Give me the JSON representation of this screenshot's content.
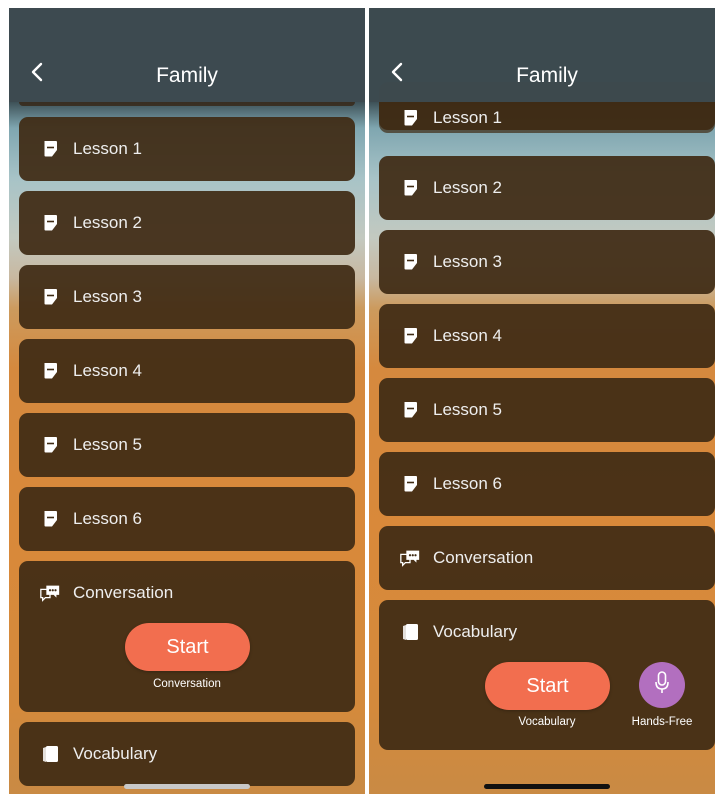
{
  "left": {
    "title": "Family",
    "lessons": [
      "Lesson 1",
      "Lesson 2",
      "Lesson 3",
      "Lesson 4",
      "Lesson 5",
      "Lesson 6"
    ],
    "conversation": {
      "label": "Conversation",
      "start_label": "Start",
      "caption": "Conversation"
    },
    "vocabulary_label": "Vocabulary"
  },
  "right": {
    "title": "Family",
    "lessons": [
      "Lesson 1",
      "Lesson 2",
      "Lesson 3",
      "Lesson 4",
      "Lesson 5",
      "Lesson 6"
    ],
    "conversation_label": "Conversation",
    "vocabulary": {
      "label": "Vocabulary",
      "start_label": "Start",
      "caption": "Vocabulary",
      "hands_free_caption": "Hands-Free"
    }
  },
  "icons": {
    "back": "chevron-left-icon",
    "lesson": "note-icon",
    "conversation": "chat-bubbles-icon",
    "vocabulary": "cards-icon",
    "hands_free": "microphone-icon"
  },
  "colors": {
    "navbar": "#3d4a50",
    "card": "#3f2b14",
    "start_button": "#f26e4f",
    "hands_free_button": "#b26fbf"
  }
}
